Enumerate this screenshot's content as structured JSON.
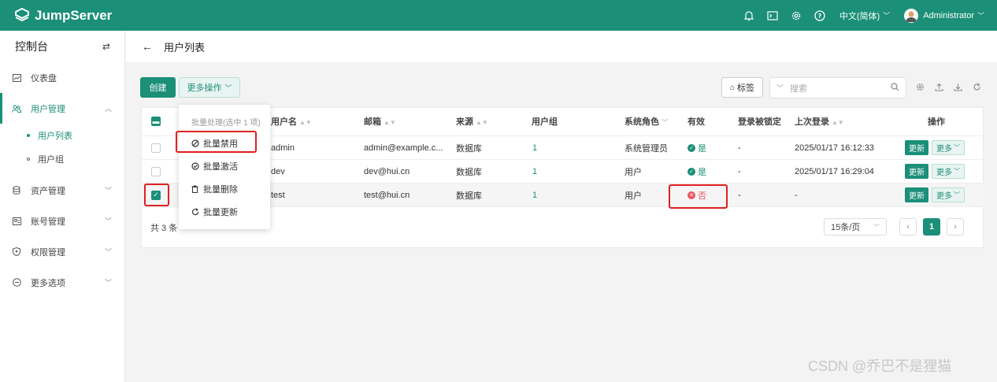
{
  "brand": {
    "name": "JumpServer"
  },
  "topbar": {
    "language": "中文(简体)",
    "user": "Administrator",
    "icons": [
      "bell-icon",
      "terminal-icon",
      "gear-icon",
      "help-icon"
    ]
  },
  "sidebar": {
    "title": "控制台",
    "items": [
      {
        "label": "仪表盘"
      },
      {
        "label": "用户管理"
      },
      {
        "label": "资产管理"
      },
      {
        "label": "账号管理"
      },
      {
        "label": "权限管理"
      },
      {
        "label": "更多选项"
      }
    ],
    "subitems": [
      {
        "label": "用户列表"
      },
      {
        "label": "用户组"
      }
    ]
  },
  "page": {
    "title": "用户列表"
  },
  "toolbar": {
    "create": "创建",
    "more": "更多操作",
    "tag": "标签",
    "search_placeholder": "搜索"
  },
  "dropdown": {
    "title": "批量处理(选中 1 项)",
    "items": [
      {
        "label": "批量禁用"
      },
      {
        "label": "批量激活"
      },
      {
        "label": "批量删除"
      },
      {
        "label": "批量更新"
      }
    ]
  },
  "table": {
    "headers": {
      "username": "用户名",
      "email": "邮箱",
      "source": "来源",
      "groups": "用户组",
      "role": "系统角色",
      "valid": "有效",
      "locked": "登录被锁定",
      "last_login": "上次登录",
      "actions": "操作"
    },
    "rows": [
      {
        "username": "admin",
        "email": "admin@example.c...",
        "source": "数据库",
        "groups": "1",
        "role": "系统管理员",
        "valid": "是",
        "locked": "-",
        "last_login": "2025/01/17 16:12:33",
        "update": "更新",
        "more": "更多"
      },
      {
        "username": "dev",
        "email": "dev@hui.cn",
        "source": "数据库",
        "groups": "1",
        "role": "用户",
        "valid": "是",
        "locked": "-",
        "last_login": "2025/01/17 16:29:04",
        "update": "更新",
        "more": "更多"
      },
      {
        "username": "test",
        "email": "test@hui.cn",
        "source": "数据库",
        "groups": "1",
        "role": "用户",
        "valid": "否",
        "locked": "-",
        "last_login": "-",
        "update": "更新",
        "more": "更多"
      }
    ]
  },
  "footer": {
    "total": "共 3 条",
    "page_size": "15条/页",
    "current_page": "1"
  },
  "watermark": "CSDN @乔巴不是狸猫",
  "colors": {
    "primary": "#1b8f78",
    "danger": "#ed5565",
    "highlight": "#e02020"
  }
}
